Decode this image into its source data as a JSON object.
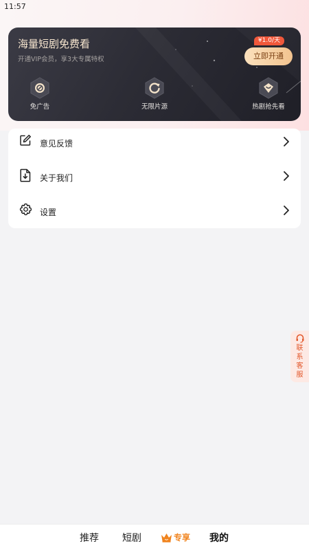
{
  "status_bar": {
    "time": "11:57"
  },
  "vip_card": {
    "title": "海量短剧免费看",
    "subtitle": "开通VIP会员，享3大专属特权",
    "price_badge": "¥1.0/天",
    "open_button": "立即开通",
    "perks": [
      {
        "label": "免广告",
        "icon": "no-ads-icon"
      },
      {
        "label": "无限片源",
        "icon": "refresh-icon"
      },
      {
        "label": "热剧抢先看",
        "icon": "heart-badge-icon"
      }
    ]
  },
  "menu": {
    "items": [
      {
        "label": "意见反馈",
        "icon": "edit-icon"
      },
      {
        "label": "关于我们",
        "icon": "document-icon"
      },
      {
        "label": "设置",
        "icon": "gear-icon"
      }
    ]
  },
  "side_service": {
    "label": "联系客服",
    "icon": "headset-icon"
  },
  "bottom_nav": {
    "items": [
      {
        "label": "推荐"
      },
      {
        "label": "短剧"
      },
      {
        "label": "专享",
        "icon": "crown-icon"
      },
      {
        "label": "我的"
      }
    ],
    "active": "我的"
  },
  "colors": {
    "accent_gold": "#f2c38f",
    "badge_red": "#f0583b",
    "service_orange": "#e2582b",
    "vip_tab_orange": "#f0841f"
  }
}
